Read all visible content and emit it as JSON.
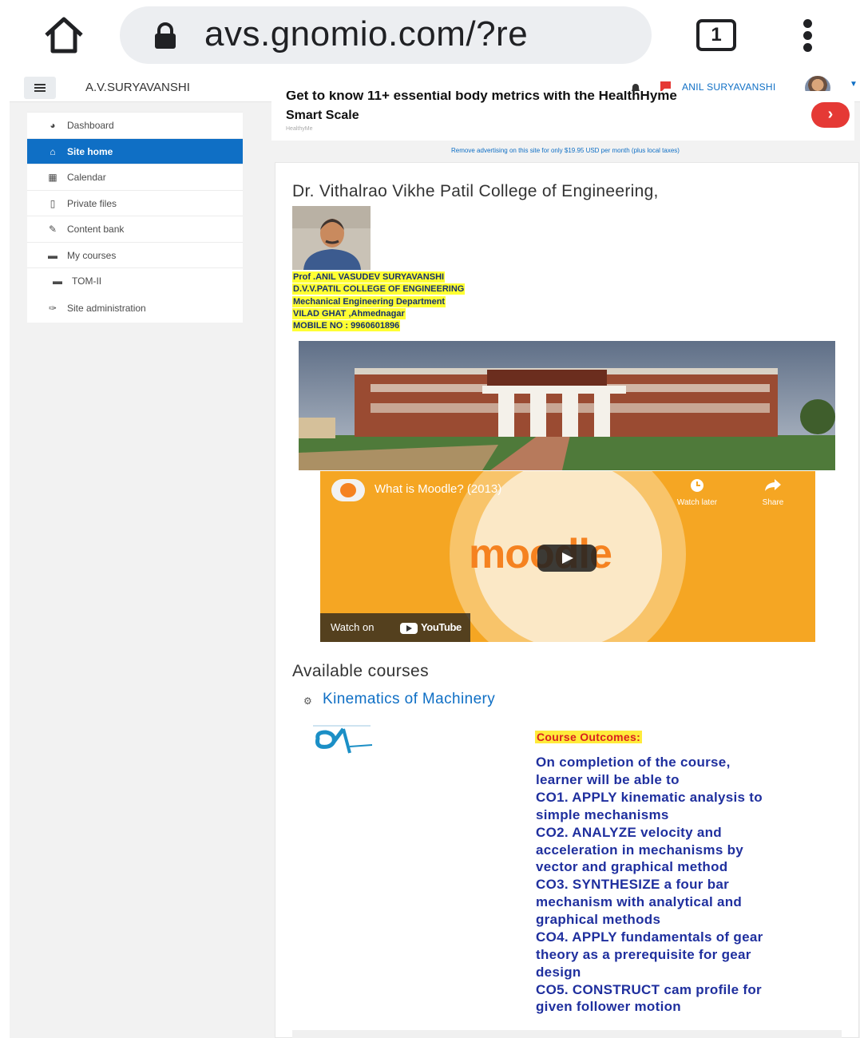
{
  "browser": {
    "url": "avs.gnomio.com/?re",
    "tab_count": "1"
  },
  "navbar": {
    "site_name": "A.V.SURYAVANSHI",
    "user_name": "ANIL SURYAVANSHI"
  },
  "sidebar": {
    "items": [
      {
        "label": "Dashboard",
        "icon": "dashboard-icon"
      },
      {
        "label": "Site home",
        "icon": "home-icon",
        "active": true
      },
      {
        "label": "Calendar",
        "icon": "calendar-icon"
      },
      {
        "label": "Private files",
        "icon": "file-icon"
      },
      {
        "label": "Content bank",
        "icon": "brush-icon"
      },
      {
        "label": "My courses",
        "icon": "graduation-cap-icon"
      },
      {
        "label": "TOM-II",
        "icon": "graduation-cap-icon"
      }
    ],
    "admin_label": "Site administration"
  },
  "ad": {
    "cutoff_text": "Get to know 11+ essential body metrics with the HealthHyme",
    "headline": "Smart Scale",
    "source": "HealthyMe",
    "remove_text": "Remove advertising on this site for only $19.95 USD per month (plus local taxes)"
  },
  "main": {
    "college_title": "Dr. Vithalrao Vikhe Patil College of Engineering,",
    "profile_lines": [
      "Prof .ANIL VASUDEV SURYAVANSHI",
      "D.V.V.PATIL COLLEGE OF ENGINEERING",
      "Mechanical Engineering Department",
      "VILAD GHAT ,Ahmednagar",
      "MOBILE NO : 9960601896"
    ],
    "video": {
      "title": "What is Moodle? (2013)",
      "watch_later": "Watch later",
      "share": "Share",
      "watch_on": "Watch on",
      "youtube": "YouTube",
      "brand_word": "moodle"
    },
    "available_title": "Available courses",
    "course_name": "Kinematics of Machinery",
    "outcomes_heading": "Course Outcomes:",
    "outcome_lines": [
      "On completion of the course,",
      "learner will be able to",
      "CO1. APPLY kinematic analysis to",
      "simple mechanisms",
      "CO2. ANALYZE velocity and",
      "acceleration in mechanisms by",
      "vector and graphical method",
      "CO3. SYNTHESIZE a four bar",
      "mechanism with analytical and",
      "graphical methods",
      "CO4. APPLY fundamentals of gear",
      "theory as a prerequisite for gear",
      "design",
      "CO5. CONSTRUCT cam profile for",
      "given follower motion"
    ]
  },
  "colors": {
    "accent": "#0f6fc5",
    "highlight": "#ffff33",
    "outcome_text": "#1f2f9e",
    "outcome_heading": "#d92020"
  }
}
